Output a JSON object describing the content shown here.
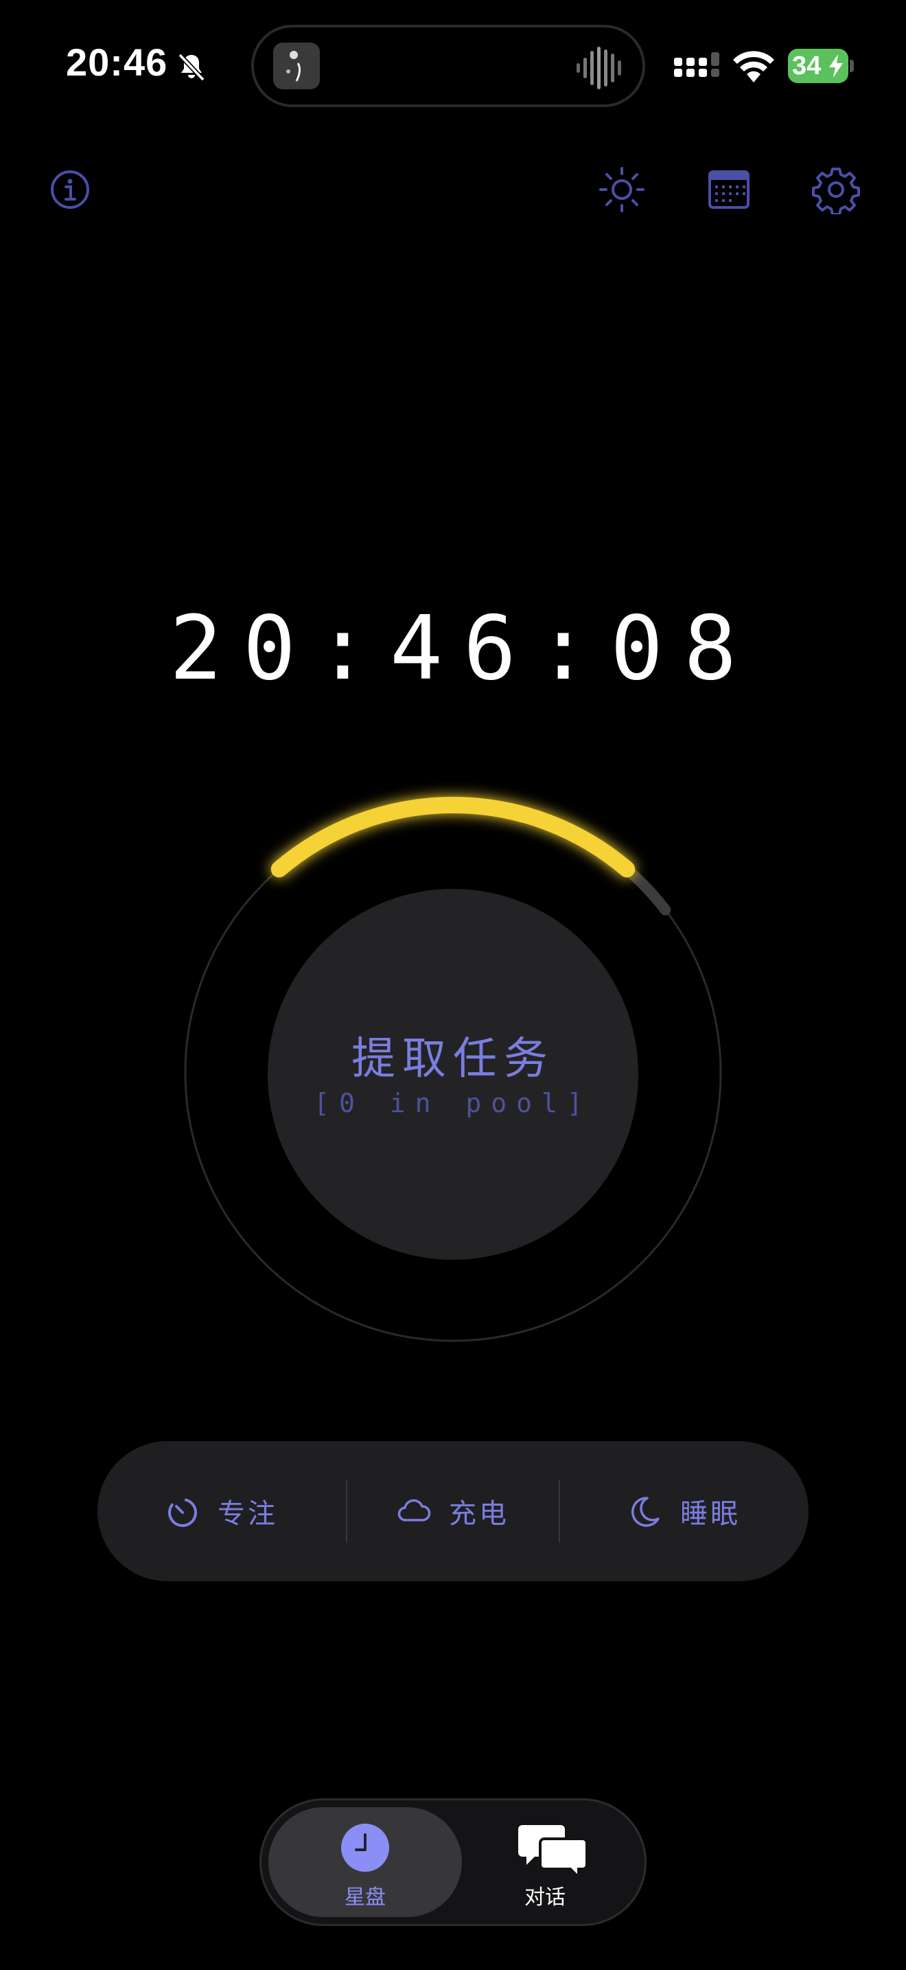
{
  "status_bar": {
    "time": "20:46",
    "battery_level": "34",
    "battery_color": "#5cc15d"
  },
  "toolbar": {
    "info_icon": "info-icon",
    "brightness_icon": "sun-icon",
    "calendar_icon": "calendar-icon",
    "settings_icon": "gear-icon"
  },
  "clock": {
    "time": "20:46:08"
  },
  "dial": {
    "progress_fraction": 0.18,
    "accent_color": "#f5d234",
    "action_title": "提取任务",
    "pool_text": "[0 in pool]"
  },
  "modes": [
    {
      "label": "专注",
      "icon": "timer-icon"
    },
    {
      "label": "充电",
      "icon": "cloud-icon"
    },
    {
      "label": "睡眠",
      "icon": "moon-icon"
    }
  ],
  "tabs": [
    {
      "label": "星盘",
      "icon": "clock-icon",
      "active": true
    },
    {
      "label": "对话",
      "icon": "chat-bubbles-icon",
      "active": false
    }
  ],
  "colors": {
    "accent": "#7a7ee0",
    "background": "#000000"
  }
}
